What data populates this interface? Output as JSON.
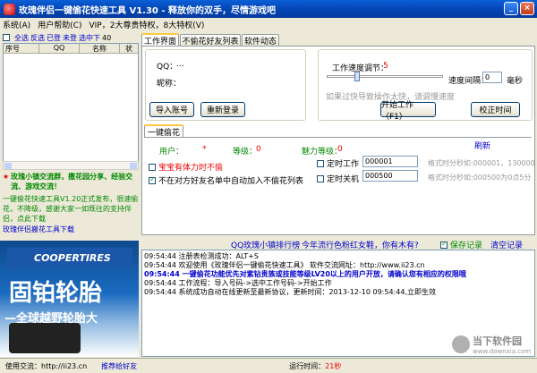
{
  "window": {
    "title": "玫瑰伴侣一键偷花快速工具 V1.30 - 释放你的双手，尽情游戏吧"
  },
  "menu": {
    "items": [
      "系统(A)",
      "用户帮助(C)",
      "VIP，2大尊贵特权，8大特权(V)"
    ]
  },
  "left": {
    "select_all": "全选",
    "invert": "反选",
    "already_selected": "已登",
    "not_selected": "未登",
    "select_middle": "选中下",
    "count": "40",
    "columns": [
      "序号",
      "QQ",
      "名称",
      "状"
    ],
    "promo1": "玫瑰小镇交流群，撒花园分享、经验交流、游戏交流！",
    "promo2": "一键偷花快速工具V1.20正式发布，很速偷花，不降级，感谢大家一如既往的支持伴侣，点此下载",
    "promo_link": "玫瑰伴侣搬花工具下载",
    "ad_brand": "COOPERTIRES",
    "ad_brand_cn": "固铂轮胎",
    "ad_title": "固铂轮胎",
    "ad_subtitle": "—全球越野轮胎大"
  },
  "tabs": [
    "工作界面",
    "不偷花好友列表",
    "软件动态"
  ],
  "account": {
    "qq_label": "QQ：",
    "qq_value": "...",
    "nick_label": "昵称：",
    "import_button": "导入账号",
    "relogin_button": "重新登录"
  },
  "speed": {
    "label": "工作速度调节：",
    "value": "5",
    "interval_label": "速度间隔：",
    "interval_value": "0",
    "interval_unit": "毫秒",
    "hint": "如果过快导致操作太快，请调慢速度",
    "start_button": "开始工作（F1）",
    "calibrate_button": "校正时间",
    "slider_fraction": 0.25
  },
  "subtab": "一键偷花",
  "status": {
    "user_label": "用户：",
    "user_value": "*",
    "level_label": "等级：",
    "level_value": "0",
    "charm_label": "魅力等级：",
    "charm_value": "0",
    "refresh": "刷新"
  },
  "options": {
    "opt1": "宝宝有体力时不偷",
    "opt2": "不在对方好友名单中自动加入不偷花列表",
    "timer_on_label": "定时工作",
    "timer_on_value": "000001",
    "timer_on_hint": "格式时分秒如:000001，130000",
    "timer_off_label": "定时关机",
    "timer_off_value": "000500",
    "timer_off_hint": "格式时分秒如:000500为0点5分"
  },
  "log": {
    "link1": "QQ玫瑰小镇排行榜",
    "link2": "今年流行色粉红女鞋，你有木有?",
    "save_label": "保存记录",
    "clear_label": "清空记录",
    "lines": [
      {
        "text": "09:54:44 注册表检测成功：ALT+S",
        "color": "#000"
      },
      {
        "text": "09:54:44 欢迎使用《玫瑰伴侣一键偷花快速工具》 软件交流网址：http://www.ii23.cn",
        "color": "#000"
      },
      {
        "text": "09:54:44 一键偷花功能优先对紫钻贵族或技能等级LV20以上的用户开放，请确认您有相应的权限哦",
        "color": "#0000cc"
      },
      {
        "text": "09:54:44 工作流程：导入号码->选中工作号码->开始工作",
        "color": "#000"
      },
      {
        "text": "09:54:44 系统成功自动在线更新至最新协议，更新时间：2013-12-10 09:54:44,立即生效",
        "color": "#000"
      }
    ]
  },
  "footer": {
    "exchange_label": "使用交流：http://ii23.cn",
    "recommend": "推荐给好友",
    "runtime_label": "运行时间：",
    "runtime_value": "21秒"
  },
  "watermark": {
    "cn": "当下软件园",
    "en": "www.downxia.com"
  }
}
